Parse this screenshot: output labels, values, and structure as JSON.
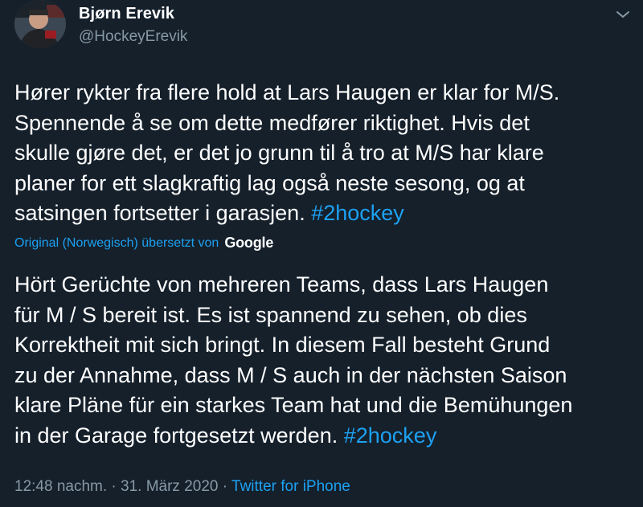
{
  "tweet": {
    "author_name": "Bjørn Erevik",
    "author_handle": "@HockeyErevik",
    "original_text": "Hører rykter fra flere hold at Lars Haugen er klar for M/S.\nSpennende å se om dette medfører riktighet. Hvis det\nskulle gjøre det, er det jo grunn til å tro at M/S har klare\nplaner for ett slagkraftig lag også neste sesong, og at\nsatsingen fortsetter i garasjen. ",
    "original_hashtag": "#2hockey",
    "translation_label": "Original (Norwegisch) übersetzt von",
    "translation_provider": "Google",
    "translated_text": "Hört Gerüchte von mehreren Teams, dass Lars Haugen\nfür M / S bereit ist. Es ist spannend zu sehen, ob dies\nKorrektheit mit sich bringt. In diesem Fall besteht Grund\nzu der Annahme, dass M / S auch in der nächsten Saison\nklare Pläne für ein starkes Team hat und die Bemühungen\nin der Garage fortgesetzt werden. ",
    "translated_hashtag": "#2hockey",
    "timestamp": "12:48 nachm. · 31. März 2020 · ",
    "source": "Twitter for iPhone"
  },
  "icons": {
    "avatar": "avatar",
    "more": "chevron-down-icon"
  },
  "colors": {
    "background": "#15202b",
    "text": "#ffffff",
    "secondary": "#8899a6",
    "accent": "#1da1f2"
  }
}
